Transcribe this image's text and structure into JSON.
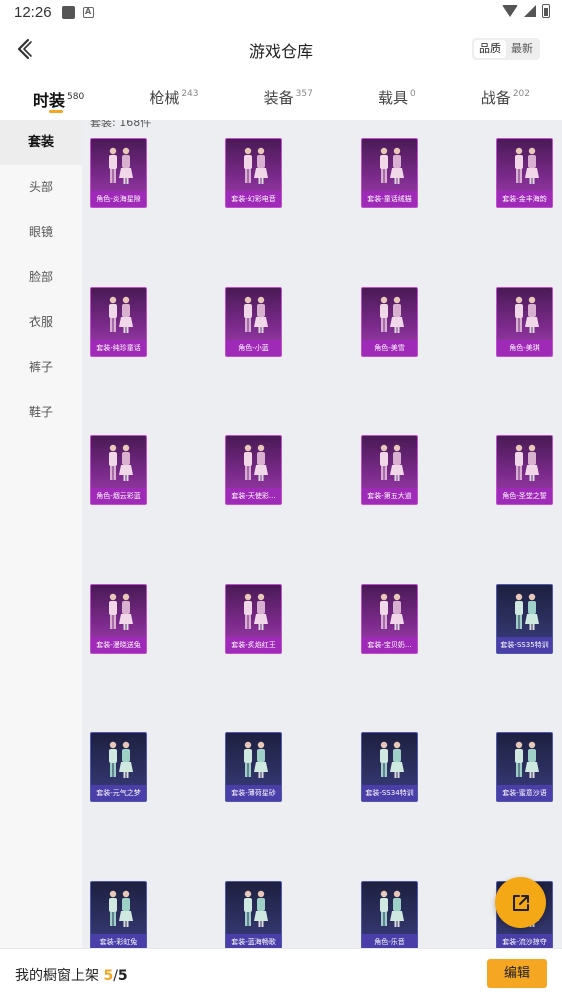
{
  "status_bar": {
    "time": "12:26",
    "notification_icon_text": "A"
  },
  "header": {
    "title": "游戏仓库",
    "sort_options": [
      "品质",
      "最新"
    ],
    "sort_active": "品质"
  },
  "tabs": [
    {
      "label": "时装",
      "count": "580",
      "active": true
    },
    {
      "label": "枪械",
      "count": "243",
      "active": false
    },
    {
      "label": "装备",
      "count": "357",
      "active": false
    },
    {
      "label": "载具",
      "count": "0",
      "active": false
    },
    {
      "label": "战备",
      "count": "202",
      "active": false
    }
  ],
  "sidebar": {
    "items": [
      {
        "label": "套装",
        "active": true
      },
      {
        "label": "头部",
        "active": false
      },
      {
        "label": "眼镜",
        "active": false
      },
      {
        "label": "脸部",
        "active": false
      },
      {
        "label": "衣服",
        "active": false
      },
      {
        "label": "裤子",
        "active": false
      },
      {
        "label": "鞋子",
        "active": false
      }
    ]
  },
  "content": {
    "count_label": "套装: 168件",
    "items": [
      {
        "label": "角色-炎海星隙",
        "tier": "pink"
      },
      {
        "label": "套装-幻彩电音",
        "tier": "pink"
      },
      {
        "label": "套装-童话绒猫",
        "tier": "pink"
      },
      {
        "label": "套装-金丰海韵",
        "tier": "pink"
      },
      {
        "label": "套装-纯珍童话",
        "tier": "pink"
      },
      {
        "label": "角色-小蓝",
        "tier": "pink"
      },
      {
        "label": "角色-美雪",
        "tier": "pink"
      },
      {
        "label": "角色-美琪",
        "tier": "pink"
      },
      {
        "label": "角色-烟云彩蓝",
        "tier": "pink"
      },
      {
        "label": "套装-天使彩...",
        "tier": "pink"
      },
      {
        "label": "套装-第五大道",
        "tier": "pink"
      },
      {
        "label": "角色-圣堂之誓",
        "tier": "pink"
      },
      {
        "label": "套装-漫晓送兔",
        "tier": "pink"
      },
      {
        "label": "套装-炙焰红王",
        "tier": "pink"
      },
      {
        "label": "套装-宝贝奶...",
        "tier": "pink"
      },
      {
        "label": "套装-SS35特训",
        "tier": "blue"
      },
      {
        "label": "套装-元气之梦",
        "tier": "blue"
      },
      {
        "label": "套装-薄荷星砂",
        "tier": "blue"
      },
      {
        "label": "套装-SS34特训",
        "tier": "blue"
      },
      {
        "label": "套装-蜜意沙语",
        "tier": "blue"
      },
      {
        "label": "套装-彩虹兔",
        "tier": "blue"
      },
      {
        "label": "套装-蓝海畅歌",
        "tier": "blue"
      },
      {
        "label": "角色-乐音",
        "tier": "blue"
      },
      {
        "label": "套装-流沙掠夺",
        "tier": "blue"
      }
    ]
  },
  "bottom": {
    "label": "我的橱窗上架",
    "current": "5",
    "separator": "/",
    "total": "5",
    "edit_label": "编辑"
  },
  "colors": {
    "accent": "#f5a623",
    "legendary_card": "#a02ab8",
    "epic_card": "#4a3fa8"
  }
}
